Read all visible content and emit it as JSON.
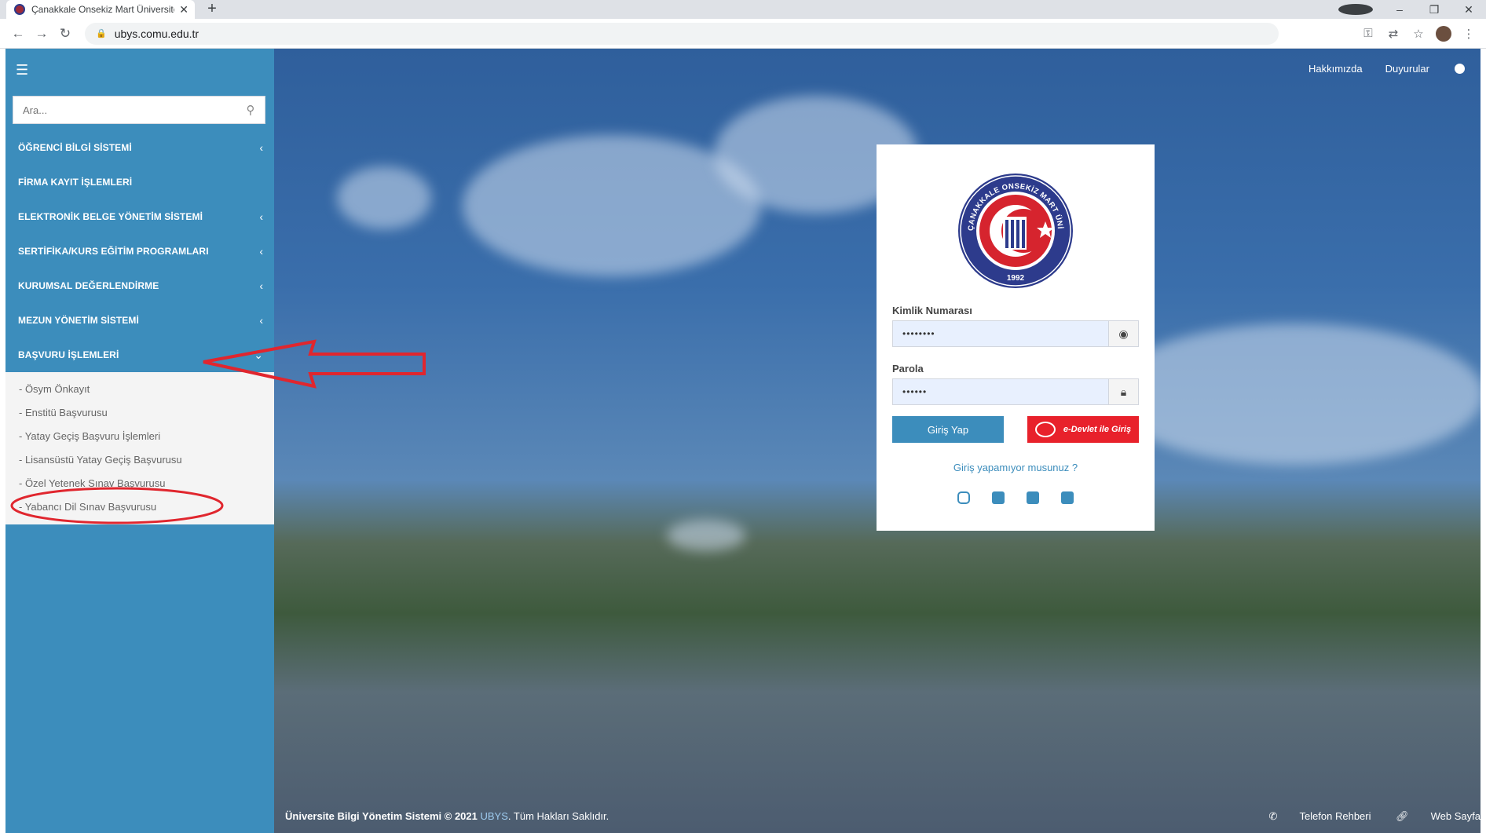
{
  "browser": {
    "tab_title": "Çanakkale Onsekiz Mart Üniversitesi",
    "url": "ubys.comu.edu.tr"
  },
  "sidebar": {
    "search_placeholder": "Ara...",
    "menu": [
      {
        "label": "ÖĞRENCİ BİLGİ SİSTEMİ",
        "has_children": true
      },
      {
        "label": "FİRMA KAYIT İŞLEMLERİ",
        "has_children": false
      },
      {
        "label": "ELEKTRONİK BELGE YÖNETİM SİSTEMİ",
        "has_children": true
      },
      {
        "label": "SERTİFİKA/KURS EĞİTİM PROGRAMLARI",
        "has_children": true
      },
      {
        "label": "KURUMSAL DEĞERLENDİRME",
        "has_children": true
      },
      {
        "label": "MEZUN YÖNETİM SİSTEMİ",
        "has_children": true
      },
      {
        "label": "BAŞVURU İŞLEMLERİ",
        "has_children": true,
        "expanded": true
      }
    ],
    "submenu": [
      "- Ösym Önkayıt",
      "- Enstitü Başvurusu",
      "- Yatay Geçiş Başvuru İşlemleri",
      "- Lisansüstü Yatay Geçiş Başvurusu",
      "- Özel Yetenek Sınav Başvurusu",
      "- Yabancı Dil Sınav Başvurusu"
    ]
  },
  "header": {
    "about": "Hakkımızda",
    "announcements": "Duyurular"
  },
  "login": {
    "logo_text": "ÇANAKKALE ONSEKİZ MART ÜNİVERSİTESİ",
    "logo_year": "1992",
    "id_label": "Kimlik Numarası",
    "id_value": "••••••••",
    "password_label": "Parola",
    "password_value": "••••••",
    "login_button": "Giriş Yap",
    "edevlet_button": "e-Devlet ile Giriş",
    "forgot": "Giriş yapamıyor musunuz ?",
    "social": [
      "instagram-icon",
      "facebook-icon",
      "twitter-icon",
      "youtube-icon"
    ]
  },
  "footer": {
    "system_name": "Üniversite Bilgi Yönetim Sistemi © 2021",
    "brand": "UBYS",
    "rights": ". Tüm Hakları Saklıdır.",
    "phonebook": "Telefon Rehberi",
    "website": "Web Sayfa"
  },
  "colors": {
    "sidebar": "#3c8dbc",
    "edevlet": "#e8212b",
    "annotation": "#e0262e"
  }
}
